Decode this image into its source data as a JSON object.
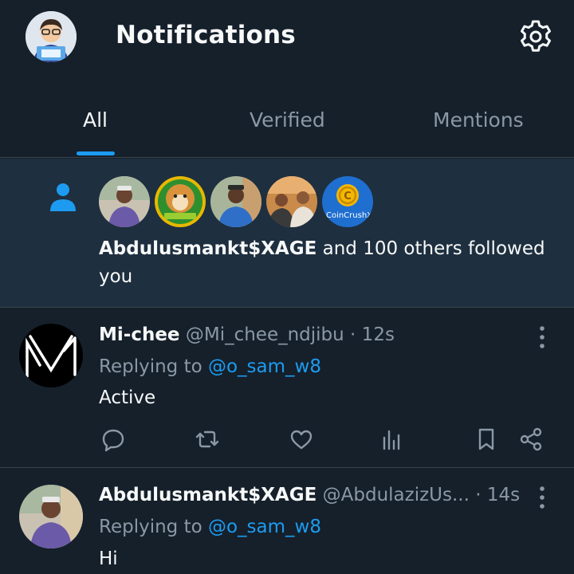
{
  "header": {
    "title": "Notifications",
    "avatar_alt": "profile-avatar",
    "settings_icon": "gear-icon"
  },
  "tabs": [
    {
      "label": "All",
      "active": true
    },
    {
      "label": "Verified",
      "active": false
    },
    {
      "label": "Mentions",
      "active": false
    }
  ],
  "follow_notification": {
    "icon": "person-icon",
    "avatars": [
      {
        "name": "avatar-abdulusmankt",
        "color": "#8a7fa6"
      },
      {
        "name": "avatar-doge-coin",
        "color": "#3a9a3a"
      },
      {
        "name": "avatar-user-blue-robe",
        "color": "#4a7fb0"
      },
      {
        "name": "avatar-two-men",
        "color": "#b0704a"
      },
      {
        "name": "avatar-coincrushx",
        "color": "#1f6fd0",
        "label": "CoinCrushX"
      }
    ],
    "actor": "Abdulusmankt$XAGE",
    "rest": " and 100 others followed you"
  },
  "tweets": [
    {
      "name": "Mi-chee",
      "handle": "@Mi_chee_ndjibu",
      "time": " · 12s",
      "reply_prefix": "Replying to ",
      "reply_to": "@o_sam_w8",
      "text": "Active"
    },
    {
      "name": "Abdulusmankt$XAGE",
      "handle": "@AbdulazizUs...",
      "time": " · 14s",
      "reply_prefix": "Replying to ",
      "reply_to": "@o_sam_w8",
      "text": "Hi"
    }
  ],
  "colors": {
    "background": "#15202b",
    "card": "#1e2f3f",
    "accent": "#1d9bf0",
    "muted": "#8b98a5",
    "text": "#f7f9f9"
  }
}
